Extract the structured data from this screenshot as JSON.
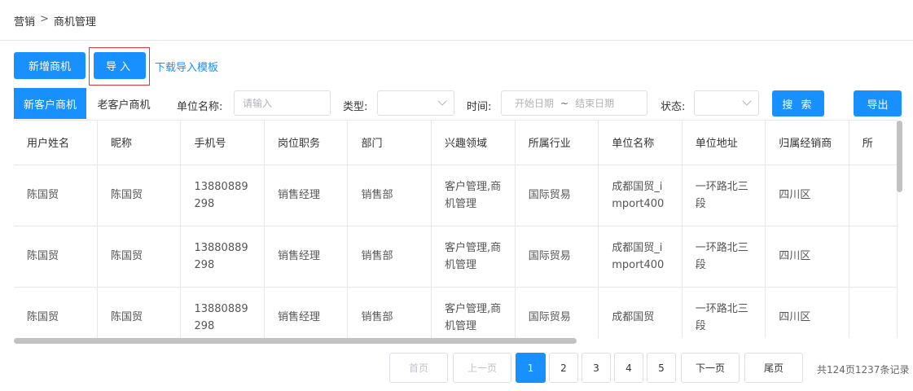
{
  "breadcrumb": {
    "parent": "营销",
    "separator": ">",
    "current": "商机管理"
  },
  "toolbar": {
    "new_label": "新增商机",
    "import_label": "导入",
    "download_template_label": "下载导入模板"
  },
  "tabs": [
    {
      "label": "新客户商机",
      "active": true
    },
    {
      "label": "老客户商机",
      "active": false
    }
  ],
  "filters": {
    "company_label": "单位名称:",
    "company_placeholder": "请输入",
    "type_label": "类型:",
    "type_value": "",
    "time_label": "时间:",
    "start_placeholder": "开始日期",
    "range_separator": "~",
    "end_placeholder": "结束日期",
    "status_label": "状态:",
    "status_value": "",
    "search_label": "搜 索",
    "export_label": "导出"
  },
  "table": {
    "columns": [
      "用户姓名",
      "昵称",
      "手机号",
      "岗位职务",
      "部门",
      "兴趣领域",
      "所属行业",
      "单位名称",
      "单位地址",
      "归属经销商",
      "所"
    ],
    "rows": [
      [
        "陈国贸",
        "陈国贸",
        "13880889298",
        "销售经理",
        "销售部",
        "客户管理,商机管理",
        "国际贸易",
        "成都国贸_import400",
        "一环路北三段",
        "四川区",
        ""
      ],
      [
        "陈国贸",
        "陈国贸",
        "13880889298",
        "销售经理",
        "销售部",
        "客户管理,商机管理",
        "国际贸易",
        "成都国贸_import400",
        "一环路北三段",
        "四川区",
        ""
      ],
      [
        "陈国贸",
        "陈国贸",
        "13880889298",
        "销售经理",
        "销售部",
        "客户管理,商机管理",
        "国际贸易",
        "成都国贸",
        "一环路北三段",
        "四川区",
        ""
      ]
    ]
  },
  "pagination": {
    "first_label": "首页",
    "prev_label": "上一页",
    "pages": [
      "1",
      "2",
      "3",
      "4",
      "5"
    ],
    "current_page": "1",
    "next_label": "下一页",
    "last_label": "尾页",
    "summary": "共124页1237条记录"
  },
  "colors": {
    "primary": "#1890ff",
    "highlight_border": "#d9363e",
    "border": "#e8e8e8"
  }
}
